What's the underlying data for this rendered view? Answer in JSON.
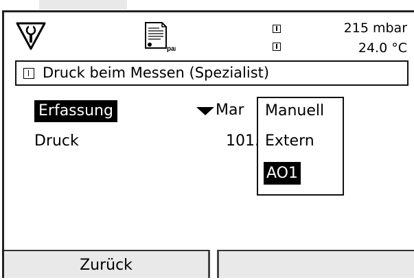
{
  "header": {
    "pressure": "215 mbar",
    "temperature": "24.0 °C",
    "doc_icon_text": "par"
  },
  "menu": {
    "title": "Druck beim Messen (Spezialist)"
  },
  "rows": [
    {
      "label": "Erfassung",
      "value": "Mar"
    },
    {
      "label": "Druck",
      "value": "101."
    }
  ],
  "dropdown": {
    "options": [
      "Manuell",
      "Extern",
      "AO1"
    ],
    "selected": "AO1"
  },
  "softkeys": {
    "left": "Zurück",
    "right": ""
  }
}
